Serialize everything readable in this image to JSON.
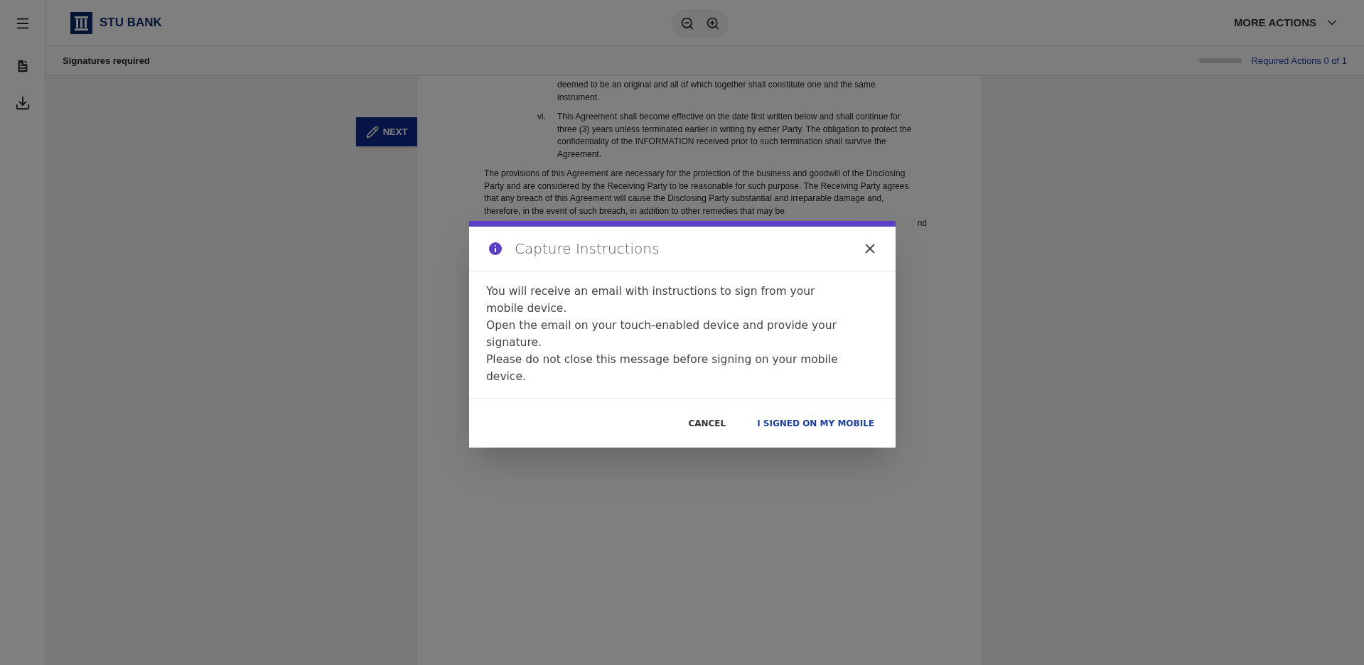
{
  "header": {
    "brand": "STU BANK",
    "more_actions": "MORE ACTIONS"
  },
  "subheader": {
    "title": "Signatures required",
    "required_actions": "Required Actions 0 of 1"
  },
  "next_button": "NEXT",
  "document": {
    "items": [
      {
        "text": "deemed to be an original and all of which together shall constitute one and the same instrument."
      },
      {
        "marker": "vi.",
        "text": "This Agreement shall become effective on the date first written below and shall continue for three (3) years unless terminated earlier in writing by either Party. The obligation to protect the confidentiality of the INFORMATION received prior to such termination shall survive the Agreement."
      }
    ],
    "paragraph": "The provisions of this Agreement are necessary for the protection of the business and goodwill of the Disclosing Party and are considered by the Receiving Party to be reasonable for such purpose. The Receiving Party agrees that any breach of this Agreement will cause the Disclosing Party substantial and irreparable damage and, therefore, in the event of such breach, in addition to other remedies that may be",
    "fragment": "nd"
  },
  "dialog": {
    "title": "Capture Instructions",
    "lines": [
      "You will receive an email with instructions to sign from your mobile device.",
      "Open the email on your touch-enabled device and provide your signature.",
      "Please do not close this message before signing on your mobile device."
    ],
    "buttons": [
      {
        "label": "CANCEL",
        "kind": "plain"
      },
      {
        "label": "I SIGNED ON MY MOBILE",
        "kind": "primary"
      }
    ]
  }
}
